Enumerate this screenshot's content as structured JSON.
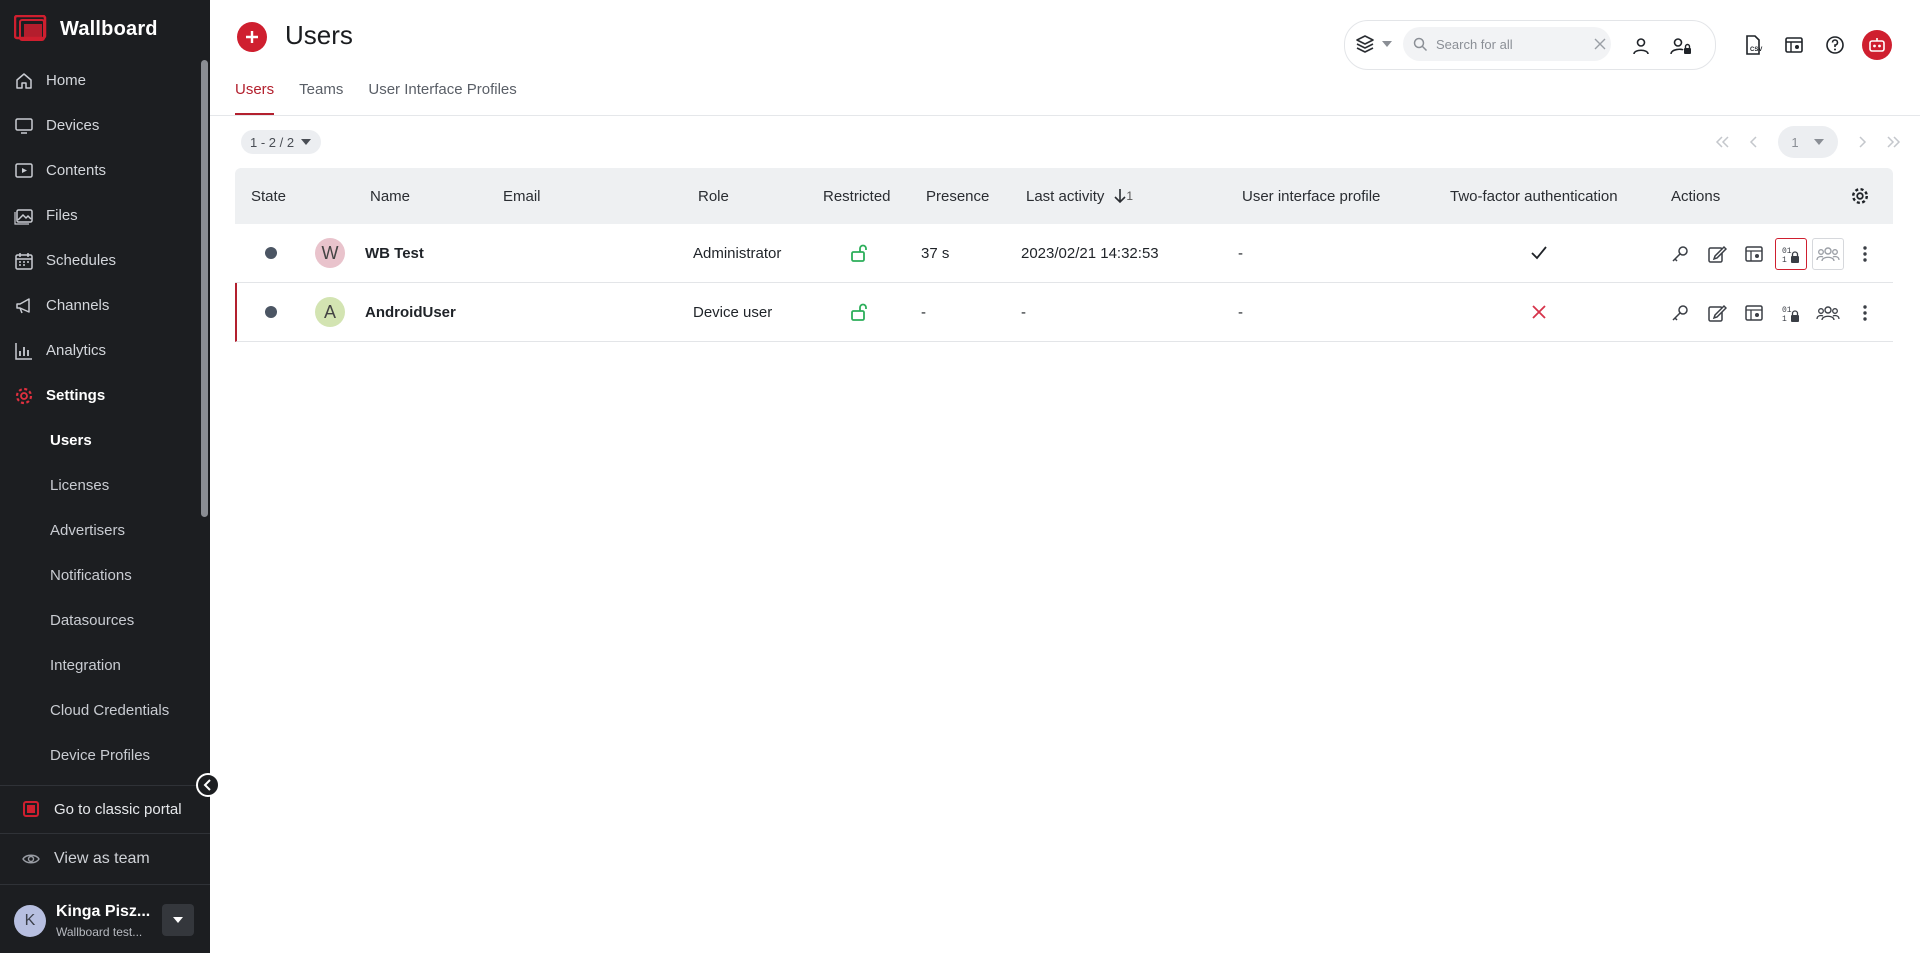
{
  "app": {
    "brand": "Wallboard",
    "accent": "#cf1f2f"
  },
  "sidebar": {
    "items": [
      {
        "label": "Home",
        "icon": "home-icon"
      },
      {
        "label": "Devices",
        "icon": "monitor-icon"
      },
      {
        "label": "Contents",
        "icon": "play-icon"
      },
      {
        "label": "Files",
        "icon": "image-icon"
      },
      {
        "label": "Schedules",
        "icon": "calendar-icon"
      },
      {
        "label": "Channels",
        "icon": "megaphone-icon"
      },
      {
        "label": "Analytics",
        "icon": "bar-chart-icon"
      },
      {
        "label": "Settings",
        "icon": "gear-icon"
      }
    ],
    "settings_sub": [
      "Users",
      "Licenses",
      "Advertisers",
      "Notifications",
      "Datasources",
      "Integration",
      "Cloud Credentials",
      "Device Profiles"
    ],
    "classic_portal": "Go to classic portal",
    "view_as_team": "View as team",
    "user": {
      "initial": "K",
      "name": "Kinga Pisz...",
      "subtitle": "Wallboard test..."
    }
  },
  "header": {
    "title": "Users",
    "search_placeholder": "Search for all"
  },
  "tabs": [
    "Users",
    "Teams",
    "User Interface Profiles"
  ],
  "paging": {
    "range": "1 - 2 / 2",
    "page": "1"
  },
  "table": {
    "columns": {
      "state": "State",
      "name": "Name",
      "email": "Email",
      "role": "Role",
      "restricted": "Restricted",
      "presence": "Presence",
      "last_activity": "Last activity",
      "sort_index": "1",
      "ui_profile": "User interface profile",
      "two_factor": "Two-factor authentication",
      "actions": "Actions"
    },
    "rows": [
      {
        "initial": "W",
        "avatar_color": "#e9c3cc",
        "name": "WB Test",
        "email": "",
        "role": "Administrator",
        "restricted": "unlocked",
        "presence": "37 s",
        "last_activity": "2023/02/21 14:32:53",
        "ui_profile": "-",
        "two_factor": true
      },
      {
        "initial": "A",
        "avatar_color": "#d3e4b2",
        "name": "AndroidUser",
        "email": "",
        "role": "Device user",
        "restricted": "unlocked",
        "presence": "-",
        "last_activity": "-",
        "ui_profile": "-",
        "two_factor": false
      }
    ]
  }
}
